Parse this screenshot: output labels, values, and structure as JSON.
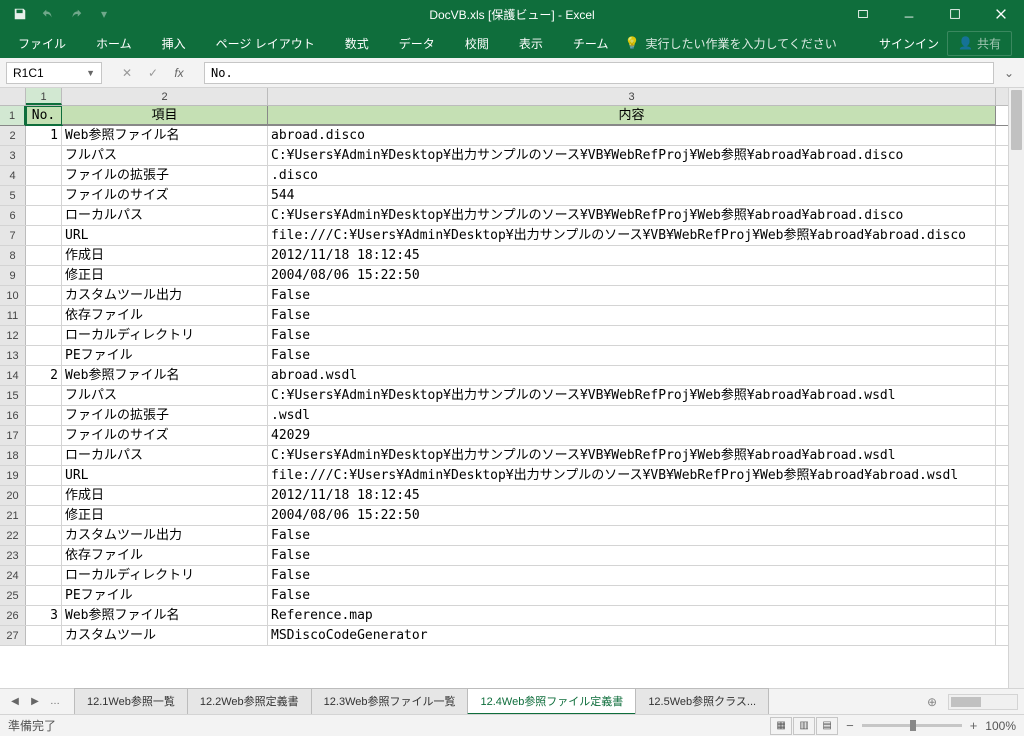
{
  "title": "DocVB.xls  [保護ビュー] - Excel",
  "ribbon": {
    "tabs": [
      "ファイル",
      "ホーム",
      "挿入",
      "ページ レイアウト",
      "数式",
      "データ",
      "校閲",
      "表示",
      "チーム"
    ],
    "tellme": "実行したい作業を入力してください",
    "signin": "サインイン",
    "share": "共有"
  },
  "namebox": "R1C1",
  "formula": "No.",
  "columns": [
    "1",
    "2",
    "3"
  ],
  "headers": {
    "c1": "No.",
    "c2": "項目",
    "c3": "内容"
  },
  "rows": [
    {
      "n": "1",
      "no": "1",
      "item": "Web参照ファイル名",
      "val": "abroad.disco"
    },
    {
      "n": "2",
      "no": "",
      "item": "フルパス",
      "val": "C:¥Users¥Admin¥Desktop¥出力サンプルのソース¥VB¥WebRefProj¥Web参照¥abroad¥abroad.disco"
    },
    {
      "n": "3",
      "no": "",
      "item": "ファイルの拡張子",
      "val": ".disco"
    },
    {
      "n": "4",
      "no": "",
      "item": "ファイルのサイズ",
      "val": "544"
    },
    {
      "n": "5",
      "no": "",
      "item": "ローカルパス",
      "val": "C:¥Users¥Admin¥Desktop¥出力サンプルのソース¥VB¥WebRefProj¥Web参照¥abroad¥abroad.disco"
    },
    {
      "n": "6",
      "no": "",
      "item": "URL",
      "val": "file:///C:¥Users¥Admin¥Desktop¥出力サンプルのソース¥VB¥WebRefProj¥Web参照¥abroad¥abroad.disco"
    },
    {
      "n": "7",
      "no": "",
      "item": "作成日",
      "val": "2012/11/18 18:12:45"
    },
    {
      "n": "8",
      "no": "",
      "item": "修正日",
      "val": "2004/08/06 15:22:50"
    },
    {
      "n": "9",
      "no": "",
      "item": "カスタムツール出力",
      "val": "False"
    },
    {
      "n": "10",
      "no": "",
      "item": "依存ファイル",
      "val": "False"
    },
    {
      "n": "11",
      "no": "",
      "item": "ローカルディレクトリ",
      "val": "False"
    },
    {
      "n": "12",
      "no": "",
      "item": "PEファイル",
      "val": "False"
    },
    {
      "n": "13",
      "no": "2",
      "item": "Web参照ファイル名",
      "val": "abroad.wsdl"
    },
    {
      "n": "14",
      "no": "",
      "item": "フルパス",
      "val": "C:¥Users¥Admin¥Desktop¥出力サンプルのソース¥VB¥WebRefProj¥Web参照¥abroad¥abroad.wsdl"
    },
    {
      "n": "15",
      "no": "",
      "item": "ファイルの拡張子",
      "val": ".wsdl"
    },
    {
      "n": "16",
      "no": "",
      "item": "ファイルのサイズ",
      "val": "42029"
    },
    {
      "n": "17",
      "no": "",
      "item": "ローカルパス",
      "val": "C:¥Users¥Admin¥Desktop¥出力サンプルのソース¥VB¥WebRefProj¥Web参照¥abroad¥abroad.wsdl"
    },
    {
      "n": "18",
      "no": "",
      "item": "URL",
      "val": "file:///C:¥Users¥Admin¥Desktop¥出力サンプルのソース¥VB¥WebRefProj¥Web参照¥abroad¥abroad.wsdl"
    },
    {
      "n": "19",
      "no": "",
      "item": "作成日",
      "val": "2012/11/18 18:12:45"
    },
    {
      "n": "20",
      "no": "",
      "item": "修正日",
      "val": "2004/08/06 15:22:50"
    },
    {
      "n": "21",
      "no": "",
      "item": "カスタムツール出力",
      "val": "False"
    },
    {
      "n": "22",
      "no": "",
      "item": "依存ファイル",
      "val": "False"
    },
    {
      "n": "23",
      "no": "",
      "item": "ローカルディレクトリ",
      "val": "False"
    },
    {
      "n": "24",
      "no": "",
      "item": "PEファイル",
      "val": "False"
    },
    {
      "n": "25",
      "no": "3",
      "item": "Web参照ファイル名",
      "val": "Reference.map"
    },
    {
      "n": "26",
      "no": "",
      "item": "カスタムツール",
      "val": "MSDiscoCodeGenerator"
    }
  ],
  "sheets": [
    "12.1Web参照一覧",
    "12.2Web参照定義書",
    "12.3Web参照ファイル一覧",
    "12.4Web参照ファイル定義書",
    "12.5Web参照クラス..."
  ],
  "activeSheet": 3,
  "status": "準備完了",
  "zoom": "100%"
}
